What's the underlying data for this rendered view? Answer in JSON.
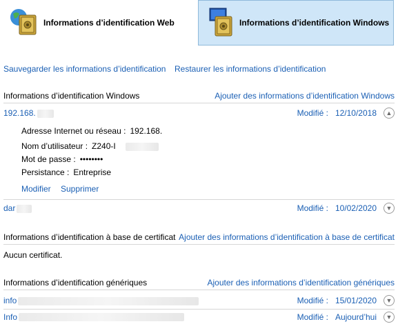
{
  "tabs": {
    "web_label": "Informations d’identification Web",
    "windows_label": "Informations d’identification Windows"
  },
  "toolbar": {
    "backup": "Sauvegarder les informations d’identification",
    "restore": "Restaurer les informations d’identification"
  },
  "windows_section": {
    "title": "Informations d’identification Windows",
    "add_link": "Ajouter des informations d’identification Windows",
    "entries": [
      {
        "name": "192.168.",
        "modified_label": "Modifié :",
        "date": "12/10/2018",
        "expanded": true,
        "details": {
          "address_label": "Adresse Internet ou réseau :",
          "address_value": "192.168.",
          "user_label": "Nom d’utilisateur :",
          "user_value": "Z240-I",
          "password_label": "Mot de passe :",
          "password_value": "••••••••",
          "persistence_label": "Persistance :",
          "persistence_value": "Entreprise"
        },
        "edit": "Modifier",
        "delete": "Supprimer"
      },
      {
        "name": "dar",
        "modified_label": "Modifié :",
        "date": "10/02/2020",
        "expanded": false
      }
    ]
  },
  "certificate_section": {
    "title": "Informations d’identification à base de certificat",
    "add_link": "Ajouter des informations d’identification à base de certificat",
    "empty_text": "Aucun certificat."
  },
  "generic_section": {
    "title": "Informations d’identification génériques",
    "add_link": "Ajouter des informations d’identification génériques",
    "entries": [
      {
        "name": "info",
        "modified_label": "Modifié :",
        "date": "15/01/2020"
      },
      {
        "name": "Info",
        "modified_label": "Modifié :",
        "date": "Aujourd’hui"
      }
    ]
  },
  "colors": {
    "link": "#1a5fb4",
    "selected_tab_bg": "#cfe6f8",
    "selected_tab_border": "#8fb9da"
  }
}
